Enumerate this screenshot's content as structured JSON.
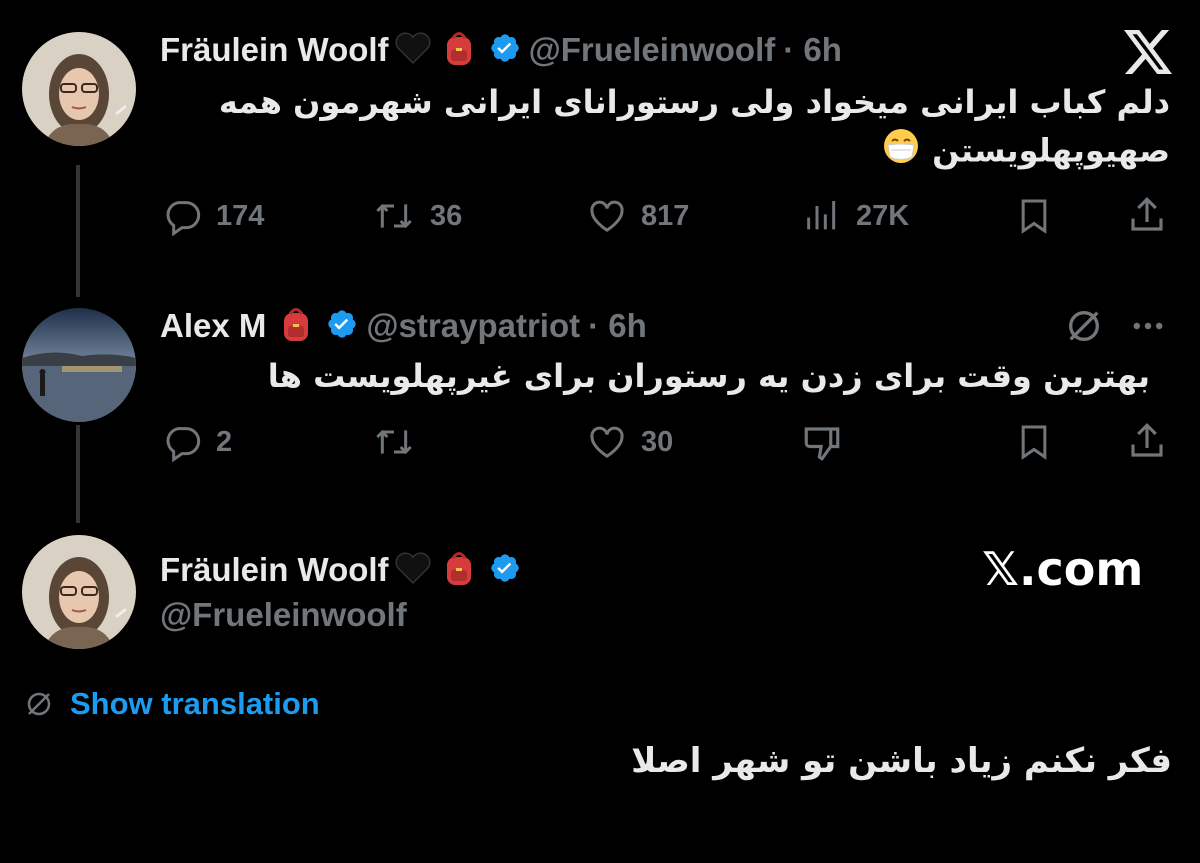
{
  "colors": {
    "background": "#000000",
    "text": "#e7e9ea",
    "muted": "#71767b",
    "accent": "#1d9bf0",
    "verified": "#1d9bf0"
  },
  "branding": {
    "x_logo_icon": "x-logo-icon",
    "watermark": "𝕏.com"
  },
  "tweet1": {
    "display_name": "Fräulein Woolf",
    "emojis": [
      "black-heart-icon",
      "backpack-icon"
    ],
    "handle": "@Frueleinwoolf",
    "time": "· 6h",
    "text_line1": "دلم کباب ایرانی میخواد ولی رستورانای ایرانی شهرمون همه",
    "text_line2": "صهیوپهلویستن",
    "text_emoji": "face-with-medical-mask-icon",
    "actions": {
      "replies": "174",
      "reposts": "36",
      "likes": "817",
      "views": "27K"
    }
  },
  "tweet2": {
    "display_name": "Alex M",
    "emojis": [
      "backpack-icon"
    ],
    "handle": "@straypatriot",
    "time": "· 6h",
    "text": "بهترین وقت برای زدن یه رستوران برای غیرپهلویست ها",
    "actions": {
      "replies": "2",
      "reposts": "",
      "likes": "30"
    }
  },
  "tweet3": {
    "display_name": "Fräulein Woolf",
    "emojis": [
      "black-heart-icon",
      "backpack-icon"
    ],
    "handle": "@Frueleinwoolf",
    "show_translation": "Show translation",
    "text": "فکر نکنم زیاد باشن تو شهر اصلا"
  }
}
